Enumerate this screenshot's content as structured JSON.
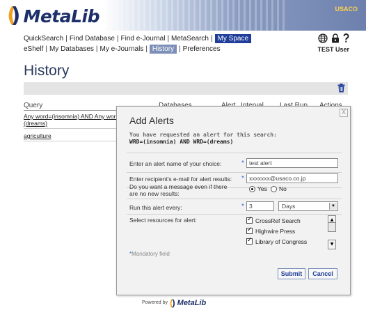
{
  "header": {
    "logo_text": "MetaLib",
    "institution": "USACO"
  },
  "nav": {
    "primary": [
      {
        "label": "QuickSearch",
        "active": false
      },
      {
        "label": "Find Database",
        "active": false
      },
      {
        "label": "Find e-Journal",
        "active": false
      },
      {
        "label": "MetaSearch",
        "active": false
      },
      {
        "label": "My Space",
        "active": true
      }
    ],
    "secondary": [
      {
        "label": "eShelf",
        "active": false
      },
      {
        "label": "My Databases",
        "active": false
      },
      {
        "label": "My e-Journals",
        "active": false
      },
      {
        "label": "History",
        "active": true
      },
      {
        "label": "Preferences",
        "active": false
      }
    ],
    "separator": "|",
    "icons": [
      "globe-icon",
      "lock-icon",
      "help-icon"
    ],
    "user": "TEST User"
  },
  "page": {
    "title": "History",
    "columns": {
      "query": "Query",
      "databases": "Databases",
      "alert": "Alert",
      "interval": "Interval",
      "last_run": "Last Run",
      "actions": "Actions"
    },
    "rows": [
      {
        "query_line1": "Any word=(insomnia) AND Any word=",
        "query_line2": "(dreams)"
      },
      {
        "query_line1": "agriculture",
        "query_line2": ""
      }
    ]
  },
  "dialog": {
    "title": "Add Alerts",
    "close": "X",
    "message_line1": "You have requested an alert for this search:",
    "message_line2": "WRD=(insomnia) AND WRD=(dreams)",
    "fields": {
      "name_label": "Enter an alert name of your choice:",
      "name_value": "test alert",
      "email_label": "Enter recipient's e-mail for alert results:",
      "email_value": "xxxxxxx@usaco.co.jp",
      "nonew_label_line1": "Do you want a message even if there",
      "nonew_label_line2": "are no new results:",
      "yes_label": "Yes",
      "no_label": "No",
      "yes_selected": true,
      "run_label": "Run this alert every:",
      "run_value": "3",
      "run_unit": "Days",
      "resources_label": "Select resources for alert:",
      "resources": [
        {
          "label": "CrossRef Search",
          "checked": true
        },
        {
          "label": "Highwire Press",
          "checked": true
        },
        {
          "label": "Library of Congress",
          "checked": true
        }
      ],
      "required_marker": "*"
    },
    "mandatory_note": "Mandatory field",
    "submit_label": "Submit",
    "cancel_label": "Cancel"
  },
  "footer": {
    "powered_by": "Powered by",
    "logo_text": "MetaLib"
  },
  "colors": {
    "brand_navy": "#1c2f6a",
    "brand_orange": "#f0a020",
    "nav_active": "#1f3d99",
    "required_star": "#3a6bd0"
  }
}
